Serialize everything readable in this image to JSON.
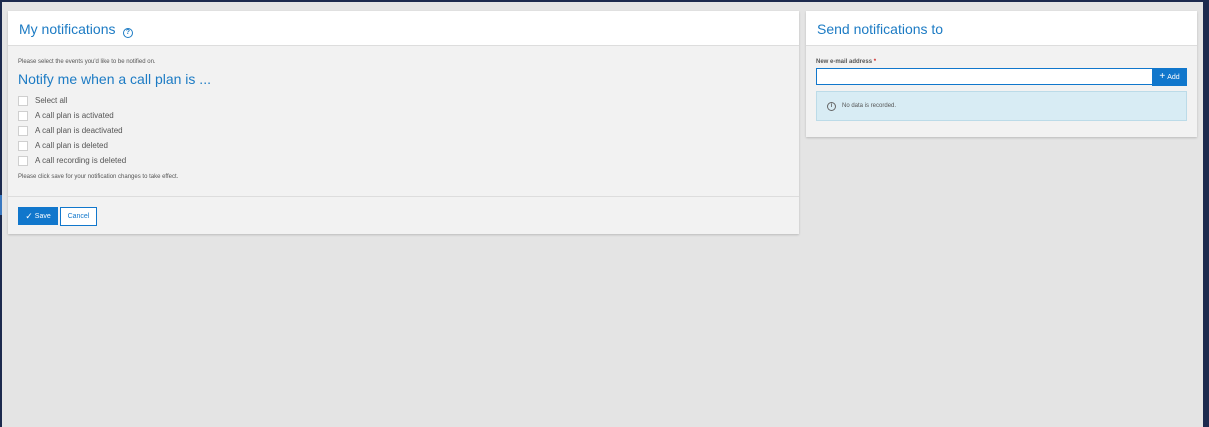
{
  "notifications_panel": {
    "title": "My notifications",
    "intro": "Please select the events you'd like to be notified on.",
    "heading": "Notify me when a call plan is ...",
    "options": [
      {
        "label": "Select all",
        "checked": false
      },
      {
        "label": "A call plan is activated",
        "checked": false
      },
      {
        "label": "A call plan is deactivated",
        "checked": false
      },
      {
        "label": "A call plan is deleted",
        "checked": false
      },
      {
        "label": "A call recording is deleted",
        "checked": false
      }
    ],
    "note": "Please click save for your notification changes to take effect.",
    "save_label": "Save",
    "cancel_label": "Cancel"
  },
  "send_panel": {
    "title": "Send notifications to",
    "email_label": "New e-mail address",
    "required_marker": "*",
    "email_value": "",
    "add_label": "Add",
    "empty_message": "No data is recorded."
  },
  "icons": {
    "help": "help-circle-icon",
    "check": "checkmark-icon",
    "plus": "plus-icon",
    "info": "info-circle-icon"
  },
  "colors": {
    "accent": "#1177cc",
    "title": "#1c7bc4",
    "info_bg": "#d8ecf4",
    "frame": "#1c2a4e"
  }
}
